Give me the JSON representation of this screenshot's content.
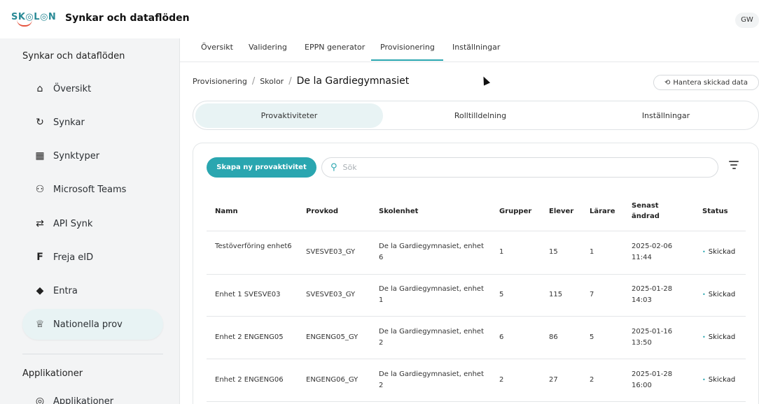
{
  "header": {
    "logo_text": "SK◎L◎N",
    "app_title": "Synkar och dataflöden",
    "avatar_initials": "GW"
  },
  "sidebar": {
    "section_title": "Synkar och dataflöden",
    "items": [
      {
        "label": "Översikt",
        "icon": "home-icon",
        "glyph": "⌂"
      },
      {
        "label": "Synkar",
        "icon": "sync-icon",
        "glyph": "↻"
      },
      {
        "label": "Synktyper",
        "icon": "grid-icon",
        "glyph": "▦"
      },
      {
        "label": "Microsoft Teams",
        "icon": "teams-icon",
        "glyph": "⚇"
      },
      {
        "label": "API Synk",
        "icon": "swap-arrows-icon",
        "glyph": "⇄"
      },
      {
        "label": "Freja eID",
        "icon": "freja-icon",
        "glyph": "F"
      },
      {
        "label": "Entra",
        "icon": "entra-icon",
        "glyph": "◆"
      },
      {
        "label": "Nationella prov",
        "icon": "trophy-icon",
        "glyph": "♕"
      }
    ],
    "section2_title": "Applikationer",
    "section2_item": "Applikationer"
  },
  "top_tabs": [
    "Översikt",
    "Validering",
    "EPPN generator",
    "Provisionering",
    "Inställningar"
  ],
  "breadcrumb": {
    "items": [
      "Provisionering",
      "Skolor"
    ],
    "current": "De la Gardiegymnasiet"
  },
  "manage_button": "Hantera skickad data",
  "segments": [
    "Provaktiviteter",
    "Rolltilldelning",
    "Inställningar"
  ],
  "toolbar": {
    "create_label": "Skapa ny provaktivitet",
    "search_placeholder": "Sök"
  },
  "table": {
    "headers": [
      "Namn",
      "Provkod",
      "Skolenhet",
      "Grupper",
      "Elever",
      "Lärare",
      "Senast ändrad",
      "Status"
    ],
    "rows": [
      [
        "Testöverföring enhet6",
        "SVESVE03_GY",
        "De la Gardiegymnasiet, enhet 6",
        "1",
        "15",
        "1",
        "2025-02-06 11:44",
        "Skickad"
      ],
      [
        "Enhet 1 SVESVE03",
        "SVESVE03_GY",
        "De la Gardiegymnasiet, enhet 1",
        "5",
        "115",
        "7",
        "2025-01-28 14:03",
        "Skickad"
      ],
      [
        "Enhet 2 ENGENG05",
        "ENGENG05_GY",
        "De la Gardiegymnasiet, enhet 2",
        "6",
        "86",
        "5",
        "2025-01-16 13:50",
        "Skickad"
      ],
      [
        "Enhet 2 ENGENG06",
        "ENGENG06_GY",
        "De la Gardiegymnasiet, enhet 2",
        "2",
        "27",
        "2",
        "2025-01-28 16:00",
        "Skickad"
      ]
    ]
  },
  "colors": {
    "accent": "#2aa6b0",
    "active_bg": "#e8f3f4",
    "sidebar_bg": "#f3f4f5"
  }
}
